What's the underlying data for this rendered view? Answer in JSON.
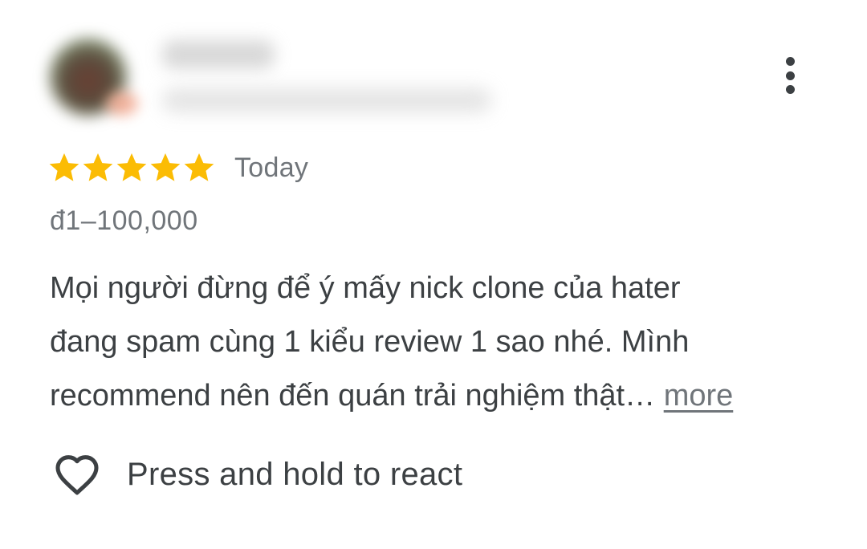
{
  "review": {
    "rating": 5,
    "max_rating": 5,
    "date": "Today",
    "price_range": "đ1–100,000",
    "text_lines": [
      "Mọi người đừng để ý mấy nick clone của hater",
      "đang spam cùng 1 kiểu review 1 sao nhé. Mình",
      "recommend nên đến quán trải nghiệm thật…"
    ],
    "more_label": "more",
    "react_label": "Press and hold to react"
  },
  "icons": {
    "star": "star-icon",
    "heart": "heart-outline-icon",
    "menu": "more-vert-icon"
  },
  "colors": {
    "star": "#FBBC04",
    "text": "#3c4043",
    "secondary_text": "#70757a"
  }
}
